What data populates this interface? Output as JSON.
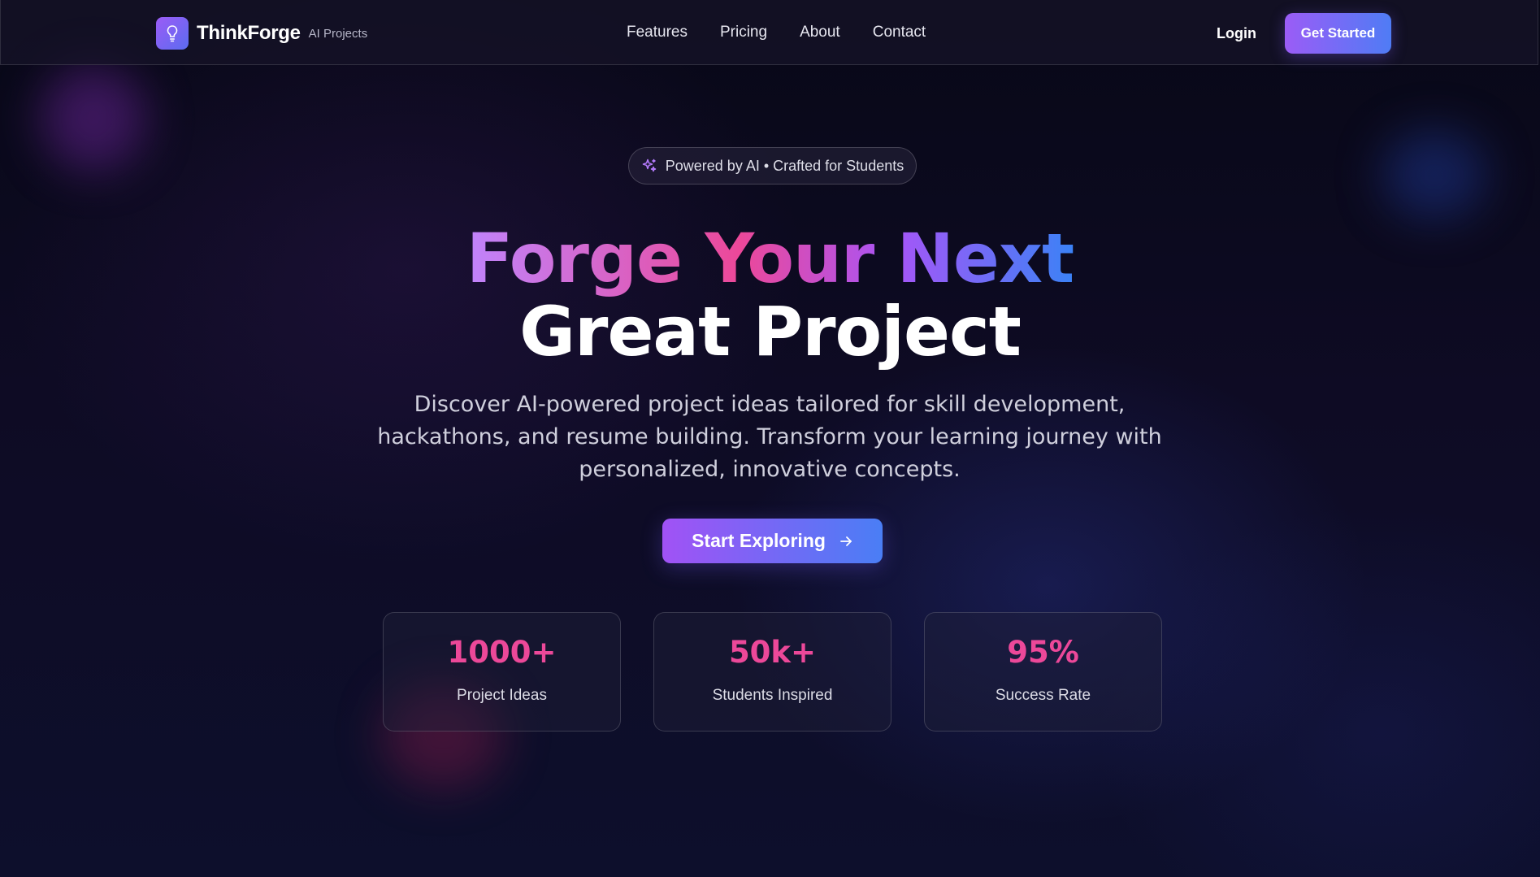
{
  "header": {
    "brand_name": "ThinkForge",
    "brand_sub": "AI Projects",
    "logo_icon": "lightbulb-icon",
    "nav": [
      {
        "label": "Features"
      },
      {
        "label": "Pricing"
      },
      {
        "label": "About"
      },
      {
        "label": "Contact"
      }
    ],
    "login_label": "Login",
    "get_started_label": "Get Started"
  },
  "hero": {
    "badge_icon": "sparkles-icon",
    "badge_text": "Powered by AI • Crafted for Students",
    "headline_line1": "Forge Your Next",
    "headline_line2": "Great Project",
    "subtitle": "Discover AI-powered project ideas tailored for skill development, hackathons, and resume building. Transform your learning journey with personalized, innovative concepts.",
    "cta_label": "Start Exploring",
    "cta_icon": "arrow-right-icon"
  },
  "stats": [
    {
      "value": "1000+",
      "label": "Project Ideas"
    },
    {
      "value": "50k+",
      "label": "Students Inspired"
    },
    {
      "value": "95%",
      "label": "Success Rate"
    }
  ],
  "colors": {
    "accent_purple": "#9b5cf6",
    "accent_blue": "#4f7cf5",
    "accent_pink": "#ec4899",
    "background": "#0b0b1d"
  }
}
